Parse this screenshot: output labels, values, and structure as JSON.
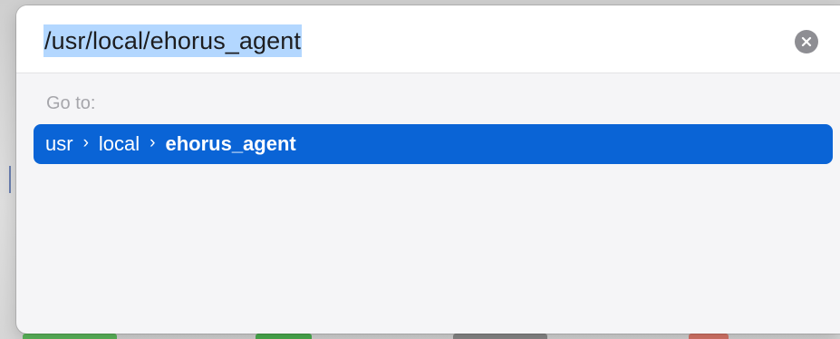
{
  "path_field": {
    "value": "/usr/local/ehorus_agent"
  },
  "clear_button": {
    "icon": "xmark-circle-icon"
  },
  "goto": {
    "label": "Go to:"
  },
  "suggestion": {
    "segments": [
      "usr",
      "local",
      "ehorus_agent"
    ],
    "separator": "›"
  },
  "colors": {
    "selection_highlight": "#b3d7ff",
    "suggestion_accent": "#0a64d6",
    "clear_button": "#8e8e93"
  }
}
